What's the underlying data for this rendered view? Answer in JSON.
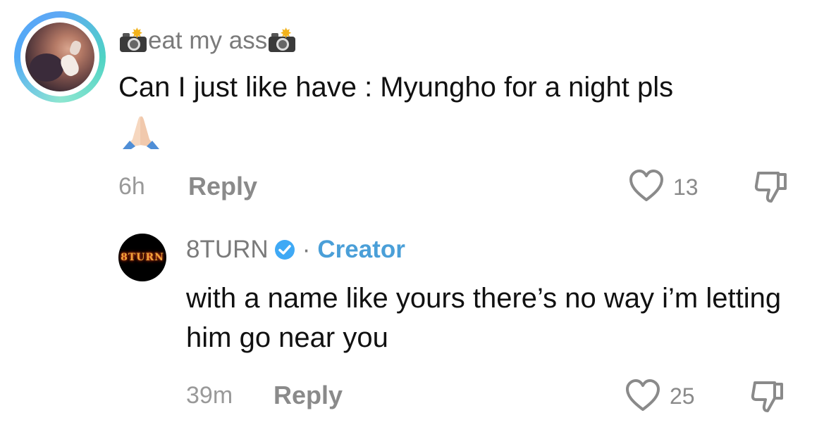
{
  "comments": [
    {
      "username": "eat my ass",
      "username_decor_icon": "camera-with-flash-icon",
      "text": "Can I just like have : Myungho for a night pls",
      "emoji_icon": "folded-hands-icon",
      "time": "6h",
      "reply_label": "Reply",
      "likes": "13"
    },
    {
      "username": "8TURN",
      "verified": true,
      "separator": "·",
      "role": "Creator",
      "avatar_text": "8TURN",
      "text": "with a name like yours there’s no way i’m letting him go near you",
      "time": "39m",
      "reply_label": "Reply",
      "likes": "25"
    }
  ],
  "colors": {
    "creator": "#4a9fd8",
    "muted": "#8a8a8a",
    "verified": "#3fa9f5"
  }
}
